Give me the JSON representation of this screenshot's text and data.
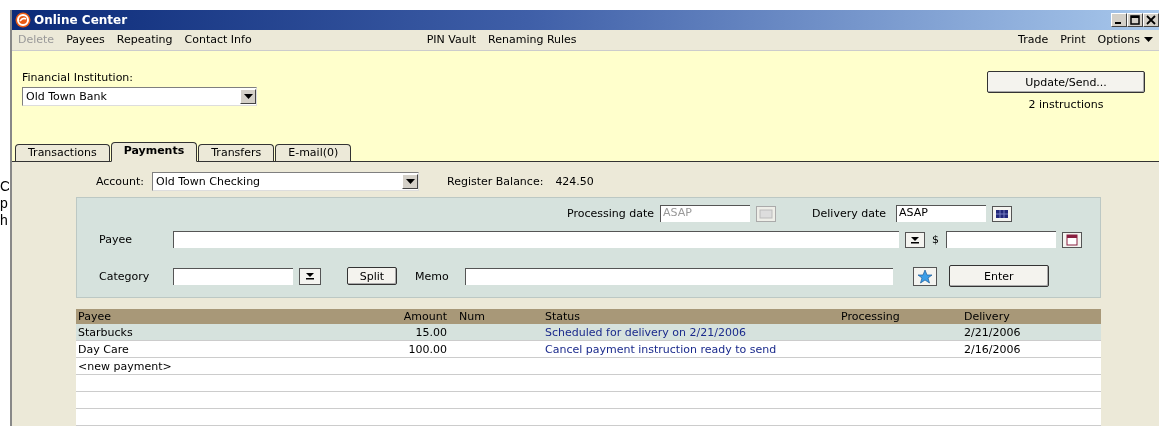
{
  "background_fragments": [
    "C",
    "p",
    "h"
  ],
  "window": {
    "title": "Online Center"
  },
  "menu": {
    "left": [
      {
        "label": "Delete",
        "disabled": true
      },
      {
        "label": "Payees",
        "disabled": false
      },
      {
        "label": "Repeating",
        "disabled": false
      },
      {
        "label": "Contact Info",
        "disabled": false
      }
    ],
    "center": [
      "PIN Vault",
      "Renaming Rules"
    ],
    "right": [
      "Trade",
      "Print",
      "Options"
    ]
  },
  "institution": {
    "label": "Financial Institution:",
    "value": "Old Town Bank"
  },
  "update": {
    "button": "Update/Send...",
    "note": "2 instructions"
  },
  "tabs": [
    {
      "label": "Transactions",
      "selected": false
    },
    {
      "label": "Payments",
      "selected": true
    },
    {
      "label": "Transfers",
      "selected": false
    },
    {
      "label": "E-mail(0)",
      "selected": false
    }
  ],
  "account": {
    "label": "Account:",
    "value": "Old Town Checking",
    "balance_label": "Register Balance:",
    "balance": "424.50"
  },
  "form": {
    "processing_label": "Processing date",
    "processing_value": "ASAP",
    "delivery_label": "Delivery date",
    "delivery_value": "ASAP",
    "payee_label": "Payee",
    "dollar": "$",
    "category_label": "Category",
    "split_button": "Split",
    "memo_label": "Memo",
    "enter_button": "Enter"
  },
  "table": {
    "columns": [
      "Payee",
      "Amount",
      "Num",
      "Status",
      "Processing",
      "Delivery"
    ],
    "rows": [
      {
        "payee": "Starbucks",
        "amount": "15.00",
        "status": "Scheduled for delivery on 2/21/2006",
        "delivery": "2/21/2006",
        "selected": true
      },
      {
        "payee": "Day Care",
        "amount": "100.00",
        "status": "Cancel payment instruction ready to send",
        "delivery": "2/16/2006",
        "selected": false
      }
    ],
    "new_row": "<new payment>"
  }
}
